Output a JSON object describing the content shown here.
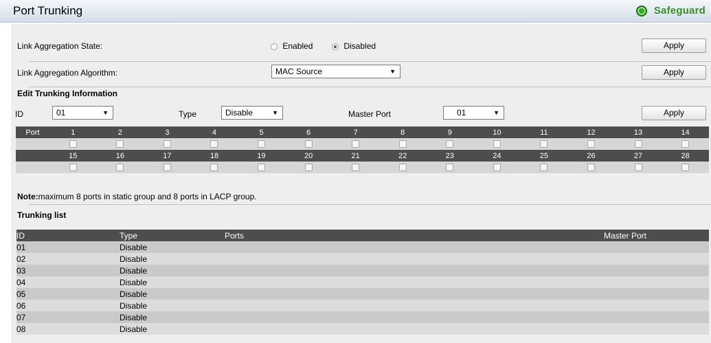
{
  "header": {
    "title": "Port Trunking",
    "safeguard_label": "Safeguard"
  },
  "link_aggregation": {
    "state_label": "Link Aggregation State:",
    "enabled_label": "Enabled",
    "disabled_label": "Disabled",
    "selected_state": "Disabled",
    "algorithm_label": "Link Aggregation Algorithm:",
    "algorithm_value": "MAC Source",
    "apply_label": "Apply"
  },
  "edit_trunking": {
    "heading": "Edit Trunking Information",
    "id_label": "ID",
    "id_value": "01",
    "type_label": "Type",
    "type_value": "Disable",
    "master_port_label": "Master Port",
    "master_port_value": "01",
    "apply_label": "Apply",
    "port_label": "Port",
    "ports_row1": [
      "1",
      "2",
      "3",
      "4",
      "5",
      "6",
      "7",
      "8",
      "9",
      "10",
      "11",
      "12",
      "13",
      "14"
    ],
    "ports_row2": [
      "15",
      "16",
      "17",
      "18",
      "19",
      "20",
      "21",
      "22",
      "23",
      "24",
      "25",
      "26",
      "27",
      "28"
    ]
  },
  "note": {
    "bold": "Note:",
    "text": "maximum 8 ports in static group and 8 ports in LACP group."
  },
  "trunking_list": {
    "heading": "Trunking list",
    "columns": [
      "ID",
      "Type",
      "Ports",
      "Master Port"
    ],
    "rows": [
      {
        "id": "01",
        "type": "Disable",
        "ports": "",
        "master": ""
      },
      {
        "id": "02",
        "type": "Disable",
        "ports": "",
        "master": ""
      },
      {
        "id": "03",
        "type": "Disable",
        "ports": "",
        "master": ""
      },
      {
        "id": "04",
        "type": "Disable",
        "ports": "",
        "master": ""
      },
      {
        "id": "05",
        "type": "Disable",
        "ports": "",
        "master": ""
      },
      {
        "id": "06",
        "type": "Disable",
        "ports": "",
        "master": ""
      },
      {
        "id": "07",
        "type": "Disable",
        "ports": "",
        "master": ""
      },
      {
        "id": "08",
        "type": "Disable",
        "ports": "",
        "master": ""
      }
    ]
  }
}
